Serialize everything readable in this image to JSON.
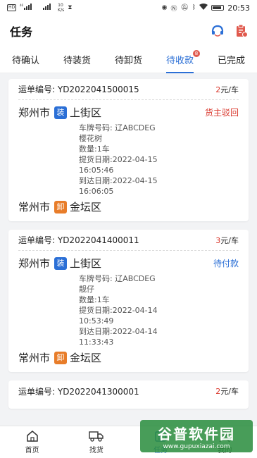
{
  "statusbar": {
    "time": "20:53",
    "speed_top": "10",
    "speed_bottom": "K/s",
    "left_a": "HD",
    "left_b": "46",
    "left_c": "2E"
  },
  "appbar": {
    "title": "任务"
  },
  "tabs": [
    {
      "label": "待确认"
    },
    {
      "label": "待装货"
    },
    {
      "label": "待卸货"
    },
    {
      "label": "待收款",
      "badge": "8"
    },
    {
      "label": "已完成"
    }
  ],
  "orders": [
    {
      "order_label": "运单编号:  YD2022041500015",
      "price_num": "2",
      "price_unit": "元/车",
      "from_city": "郑州市",
      "from_badge": "装",
      "from_district": "上街区",
      "status": "货主驳回",
      "status_color": "#d9362b",
      "plate": "车牌号码:  辽ABCDEG",
      "driver": "樱花树",
      "qty": "数量:1车",
      "pickup_label": "提货日期:2022-04-15",
      "pickup_time": "16:05:46",
      "arrive_label": "到达日期:2022-04-15",
      "arrive_time": "16:06:05",
      "to_city": "常州市",
      "to_badge": "卸",
      "to_district": "金坛区"
    },
    {
      "order_label": "运单编号:  YD2022041400011",
      "price_num": "3",
      "price_unit": "元/车",
      "from_city": "郑州市",
      "from_badge": "装",
      "from_district": "上街区",
      "status": "待付款",
      "status_color": "#2b6fd6",
      "plate": "车牌号码:  辽ABCDEG",
      "driver": "靓仔",
      "qty": "数量:1车",
      "pickup_label": "提货日期:2022-04-14",
      "pickup_time": "10:53:49",
      "arrive_label": "到达日期:2022-04-14",
      "arrive_time": "11:33:43",
      "to_city": "常州市",
      "to_badge": "卸",
      "to_district": "金坛区"
    },
    {
      "order_label": "运单编号:  YD2022041300001",
      "price_num": "2",
      "price_unit": "元/车"
    }
  ],
  "nav": [
    {
      "label": "首页",
      "icon": "home-icon"
    },
    {
      "label": "找货",
      "icon": "truck-icon"
    },
    {
      "label": "任务",
      "icon": "task-icon"
    },
    {
      "label": "我的",
      "icon": "user-icon"
    }
  ],
  "watermark": {
    "main": "谷普软件园",
    "sub": "www.gupuxiazai.com"
  },
  "colors": {
    "primary": "#2b6fd6",
    "danger": "#d9362b",
    "load": "#2b6fd6",
    "unload": "#e87d2a"
  }
}
